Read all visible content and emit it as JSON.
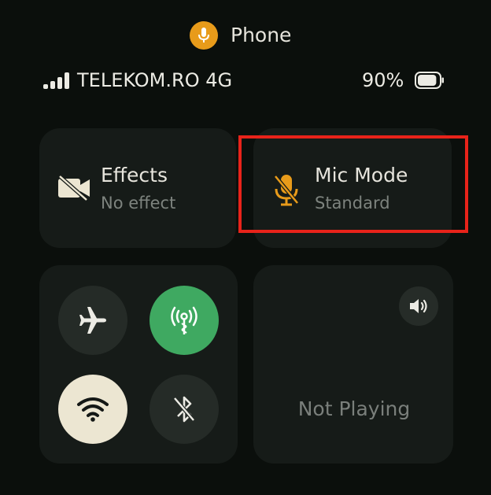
{
  "status_bar": {
    "mic_indicator_label": "Phone",
    "carrier": "TELEKOM.RO 4G",
    "battery_percent": "90%",
    "battery_level": 0.9,
    "signal_bars": 4
  },
  "tiles": {
    "effects": {
      "title": "Effects",
      "subtitle": "No effect",
      "icon": "video-off-icon"
    },
    "mic_mode": {
      "title": "Mic Mode",
      "subtitle": "Standard",
      "icon": "mic-off-icon"
    }
  },
  "connectivity": [
    {
      "name": "airplane-mode",
      "icon": "airplane-icon",
      "active": false
    },
    {
      "name": "cellular-data",
      "icon": "antenna-icon",
      "active": true
    },
    {
      "name": "wifi",
      "icon": "wifi-icon",
      "active": true
    },
    {
      "name": "bluetooth",
      "icon": "bluetooth-off-icon",
      "active": false
    }
  ],
  "media": {
    "status": "Not Playing",
    "volume_icon": "speaker-icon"
  },
  "colors": {
    "background": "#0b0f0c",
    "tile": "#161b18",
    "accent_orange": "#e89b1a",
    "data_green": "#3fa961",
    "wifi_cream": "#ece6d2",
    "highlight_red": "#e8231a"
  }
}
